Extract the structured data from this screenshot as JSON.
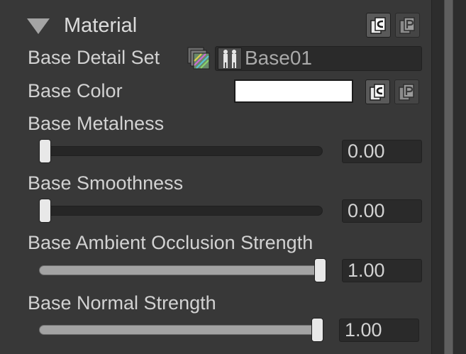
{
  "section": {
    "title": "Material"
  },
  "fields": {
    "base_detail_set": {
      "label": "Base Detail Set",
      "value": "Base01"
    },
    "base_color": {
      "label": "Base Color",
      "color": "#ffffff"
    },
    "base_metalness": {
      "label": "Base Metalness",
      "value": "0.00",
      "level": 0.0
    },
    "base_smoothness": {
      "label": "Base Smoothness",
      "value": "0.00",
      "level": 0.0
    },
    "base_ao_strength": {
      "label": "Base Ambient Occlusion Strength",
      "value": "1.00",
      "level": 1.0
    },
    "base_normal_strength": {
      "label": "Base Normal Strength",
      "value": "1.00",
      "level": 1.0
    }
  },
  "icons": {
    "copy": "copy-icon",
    "paste": "paste-icon",
    "detail_texture": "detail-texture-icon",
    "asset_preview": "asset-preview-icon"
  }
}
